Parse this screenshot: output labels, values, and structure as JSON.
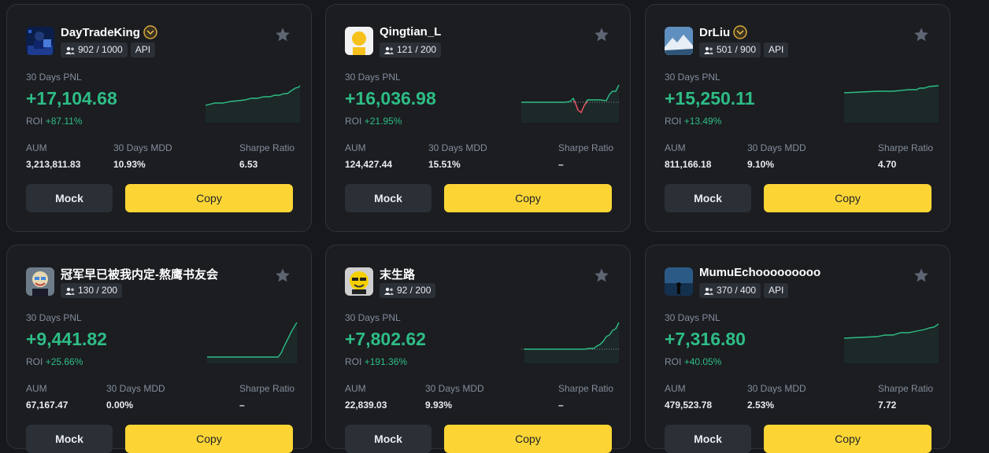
{
  "colors": {
    "positive": "#2ebd85",
    "negative": "#f6465d",
    "accent": "#fcd535",
    "muted": "#848e9c"
  },
  "labels": {
    "pnl": "30 Days PNL",
    "roi": "ROI",
    "aum": "AUM",
    "mdd": "30 Days MDD",
    "sharpe": "Sharpe Ratio",
    "mock": "Mock",
    "copy": "Copy"
  },
  "cards": [
    {
      "name": "DayTradeKing",
      "medal": true,
      "followers": "902 / 1000",
      "api": "API",
      "pnl": "+17,104.68",
      "roi": "+87.11%",
      "aum": "3,213,811.83",
      "mdd": "10.93%",
      "sharpe": "6.53",
      "avatar": "person-laptop-icon"
    },
    {
      "name": "Qingtian_L",
      "medal": false,
      "followers": "121 / 200",
      "api": "",
      "pnl": "+16,036.98",
      "roi": "+21.95%",
      "aum": "124,427.44",
      "mdd": "15.51%",
      "sharpe": "–",
      "avatar": "yellow-circle-icon"
    },
    {
      "name": "DrLiu",
      "medal": true,
      "followers": "501 / 900",
      "api": "API",
      "pnl": "+15,250.11",
      "roi": "+13.49%",
      "aum": "811,166.18",
      "mdd": "9.10%",
      "sharpe": "4.70",
      "avatar": "mountain-landscape-icon"
    },
    {
      "name": "冠军早已被我内定-熬鹰书友会",
      "medal": false,
      "followers": "130 / 200",
      "api": "",
      "pnl": "+9,441.82",
      "roi": "+25.66%",
      "aum": "67,167.47",
      "mdd": "0.00%",
      "sharpe": "–",
      "avatar": "cartoon-character-icon"
    },
    {
      "name": "末生路",
      "medal": false,
      "followers": "92 / 200",
      "api": "",
      "pnl": "+7,802.62",
      "roi": "+191.36%",
      "aum": "22,839.03",
      "mdd": "9.93%",
      "sharpe": "–",
      "avatar": "sunglasses-face-icon"
    },
    {
      "name": "MumuEchooooooooo",
      "medal": false,
      "followers": "370 / 400",
      "api": "API",
      "pnl": "+7,316.80",
      "roi": "+40.05%",
      "aum": "479,523.78",
      "mdd": "2.53%",
      "sharpe": "7.72",
      "avatar": "cat-by-sea-icon"
    }
  ]
}
